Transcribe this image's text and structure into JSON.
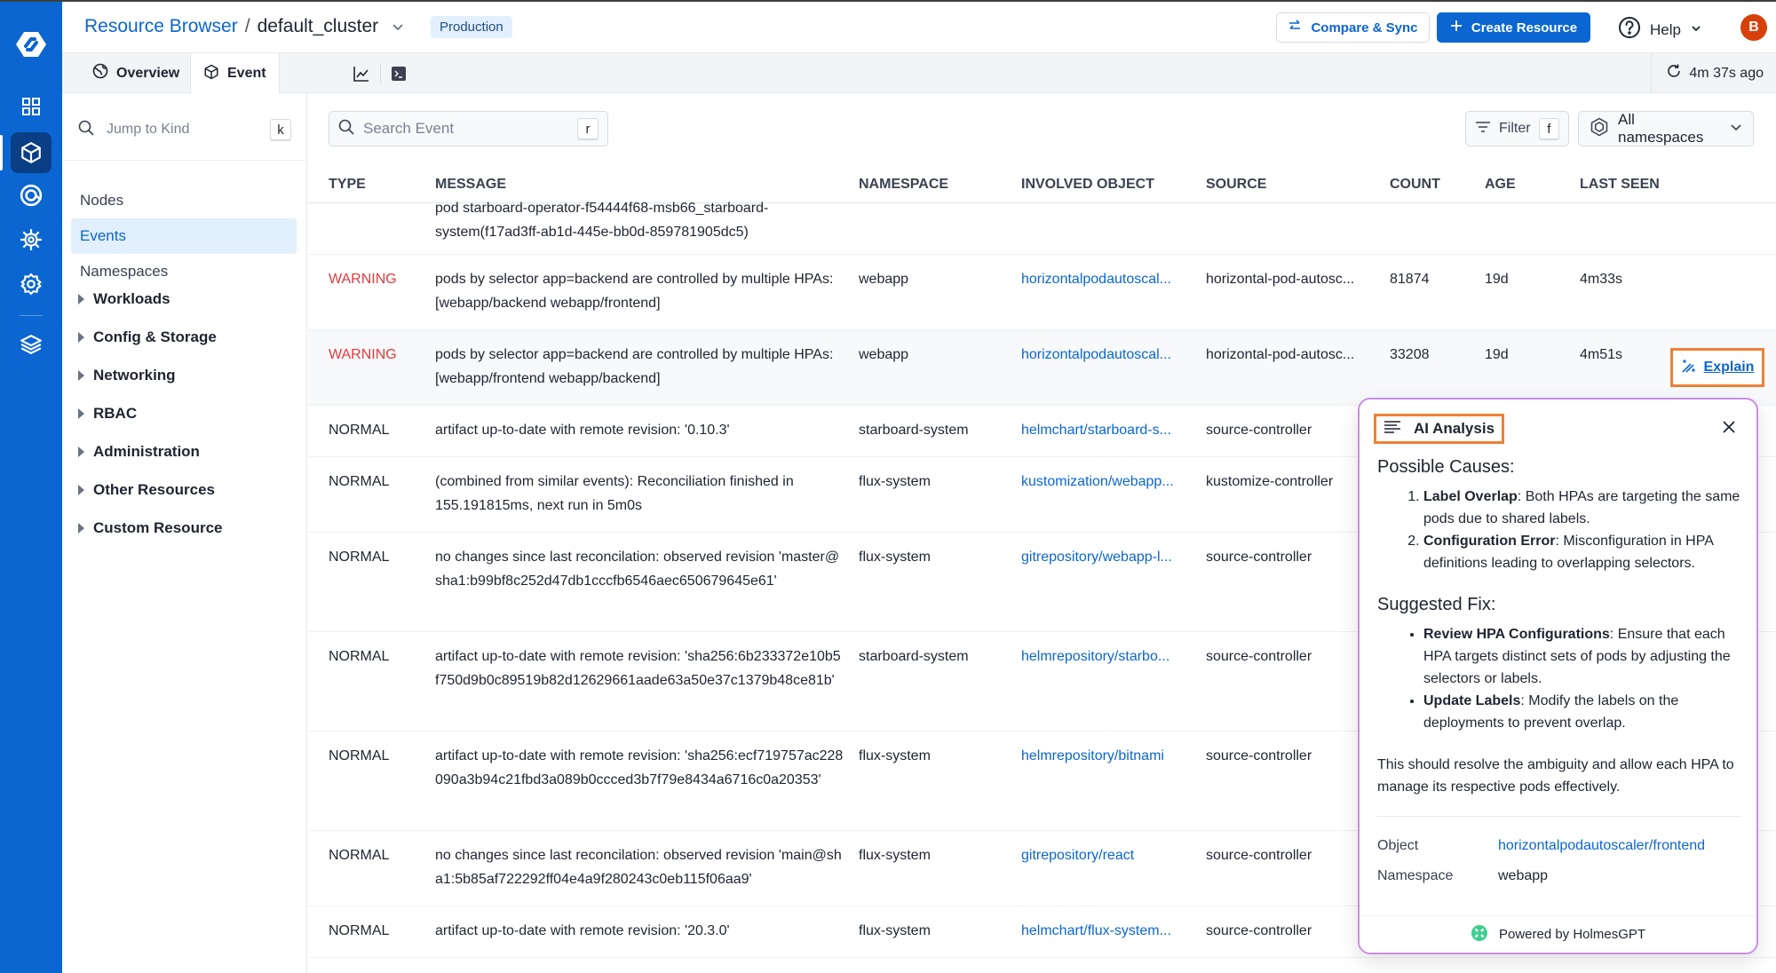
{
  "header": {
    "breadcrumb_root": "Resource Browser",
    "breadcrumb_sep": "/",
    "cluster": "default_cluster",
    "env_badge": "Production",
    "compare_sync": "Compare & Sync",
    "create_resource": "Create Resource",
    "help": "Help",
    "avatar_initial": "B"
  },
  "tabs": {
    "overview": "Overview",
    "event": "Event",
    "refresh_status": "4m 37s ago"
  },
  "nav": {
    "jump_placeholder": "Jump to Kind",
    "jump_shortcut": "k",
    "items": [
      "Nodes",
      "Events",
      "Namespaces"
    ],
    "active_item": "Events",
    "groups": [
      "Workloads",
      "Config & Storage",
      "Networking",
      "RBAC",
      "Administration",
      "Other Resources",
      "Custom Resource"
    ]
  },
  "toolbar": {
    "search_placeholder": "Search Event",
    "search_shortcut": "r",
    "filter_label": "Filter",
    "filter_shortcut": "f",
    "namespace_selected": "All namespaces"
  },
  "table": {
    "columns": [
      "TYPE",
      "MESSAGE",
      "NAMESPACE",
      "INVOLVED OBJECT",
      "SOURCE",
      "COUNT",
      "AGE",
      "LAST SEEN"
    ],
    "rows": [
      {
        "type": "",
        "message": "pod starboard-operator-f54444f68-msb66_starboard-system(f17ad3ff-ab1d-445e-bb0d-859781905dc5)",
        "namespace": "",
        "object": "",
        "source": "",
        "count": "",
        "age": "",
        "last_seen": ""
      },
      {
        "type": "WARNING",
        "message": "pods by selector app=backend are controlled by multiple HPAs: [webapp/backend webapp/frontend]",
        "namespace": "webapp",
        "object": "horizontalpodautoscal...",
        "source": "horizontal-pod-autosc...",
        "count": "81874",
        "age": "19d",
        "last_seen": "4m33s"
      },
      {
        "type": "WARNING",
        "message": "pods by selector app=backend are controlled by multiple HPAs: [webapp/frontend webapp/backend]",
        "namespace": "webapp",
        "object": "horizontalpodautoscal...",
        "source": "horizontal-pod-autosc...",
        "count": "33208",
        "age": "19d",
        "last_seen": "4m51s",
        "action": "Explain"
      },
      {
        "type": "NORMAL",
        "message": "artifact up-to-date with remote revision: '0.10.3'",
        "namespace": "starboard-system",
        "object": "helmchart/starboard-s...",
        "source": "source-controller",
        "count": "",
        "age": "",
        "last_seen": ""
      },
      {
        "type": "NORMAL",
        "message": "(combined from similar events): Reconciliation finished in 155.191815ms, next run in 5m0s",
        "namespace": "flux-system",
        "object": "kustomization/webapp...",
        "source": "kustomize-controller",
        "count": "",
        "age": "",
        "last_seen": ""
      },
      {
        "type": "NORMAL",
        "message": "no changes since last reconcilation: observed revision 'master@sha1:b99bf8c252d47db1cccfb6546aec650679645e61'",
        "namespace": "flux-system",
        "object": "gitrepository/webapp-l...",
        "source": "source-controller",
        "count": "",
        "age": "",
        "last_seen": ""
      },
      {
        "type": "NORMAL",
        "message": "artifact up-to-date with remote revision: 'sha256:6b233372e10b5f750d9b0c89519b82d12629661aade63a50e37c1379b48ce81b'",
        "namespace": "starboard-system",
        "object": "helmrepository/starbo...",
        "source": "source-controller",
        "count": "",
        "age": "",
        "last_seen": ""
      },
      {
        "type": "NORMAL",
        "message": "artifact up-to-date with remote revision: 'sha256:ecf719757ac228090a3b94c21fbd3a089b0ccced3b7f79e8434a6716c0a20353'",
        "namespace": "flux-system",
        "object": "helmrepository/bitnami",
        "source": "source-controller",
        "count": "",
        "age": "",
        "last_seen": ""
      },
      {
        "type": "NORMAL",
        "message": "no changes since last reconcilation: observed revision 'main@sha1:5b85af722292ff04e4a9f280243c0eb115f06aa9'",
        "namespace": "flux-system",
        "object": "gitrepository/react",
        "source": "source-controller",
        "count": "",
        "age": "",
        "last_seen": ""
      },
      {
        "type": "NORMAL",
        "message": "artifact up-to-date with remote revision: '20.3.0'",
        "namespace": "flux-system",
        "object": "helmchart/flux-system...",
        "source": "source-controller",
        "count": "",
        "age": "",
        "last_seen": ""
      }
    ]
  },
  "ai_panel": {
    "title": "AI Analysis",
    "causes_heading": "Possible Causes:",
    "causes": [
      {
        "bold": "Label Overlap",
        "text": ": Both HPAs are targeting the same pods due to shared labels."
      },
      {
        "bold": "Configuration Error",
        "text": ": Misconfiguration in HPA definitions leading to overlapping selectors."
      }
    ],
    "fix_heading": "Suggested Fix:",
    "fixes": [
      {
        "bold": "Review HPA Configurations",
        "text": ": Ensure that each HPA targets distinct sets of pods by adjusting the selectors or labels."
      },
      {
        "bold": "Update Labels",
        "text": ": Modify the labels on the deployments to prevent overlap."
      }
    ],
    "conclusion": "This should resolve the ambiguity and allow each HPA to manage its respective pods effectively.",
    "meta": [
      {
        "key": "Object",
        "value": "horizontalpodautoscaler/frontend",
        "link": true
      },
      {
        "key": "Namespace",
        "value": "webapp",
        "link": false
      }
    ],
    "footer": "Powered by HolmesGPT"
  },
  "colors": {
    "brand": "#0b66d1",
    "warning": "#e5393e",
    "highlight": "#f07f35",
    "holmes": "#3ecf8e"
  }
}
